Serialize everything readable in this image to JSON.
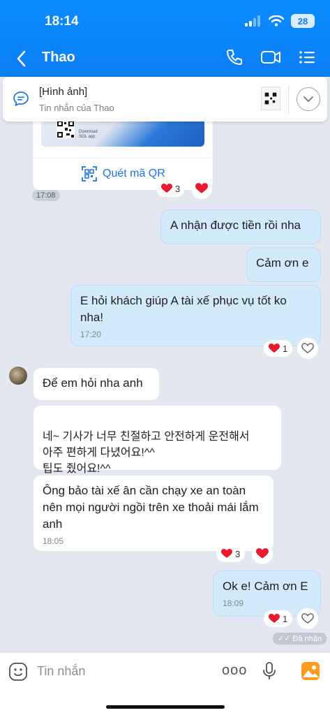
{
  "status": {
    "time": "18:14",
    "battery": "28"
  },
  "header": {
    "title": "Thao"
  },
  "pinned": {
    "title": "[Hình ảnh]",
    "subtitle": "Tin nhắn của Thao"
  },
  "image_card": {
    "download_text": "Download",
    "app_text": "SOL app",
    "qr_link": "Quét mã QR",
    "time": "17:08"
  },
  "reactions_1": {
    "count": "3"
  },
  "messages": [
    {
      "text": "A nhận được tiền rồi nha"
    },
    {
      "text": "Cảm ơn e"
    },
    {
      "text": "E hỏi khách giúp A tài xế phục vụ tốt ko nha!",
      "time": "17:20",
      "react_count": "1"
    },
    {
      "text": "Để em hỏi nha anh"
    },
    {
      "text": "네~ 기사가 너무 친절하고 안전하게 운전해서\n아주 편하게 다녔어요!^^\n팁도 줬어요!^^"
    },
    {
      "text": "Ông bảo tài xế ân cần chạy xe an toàn nên mọi người ngồi trên xe thoải mái lắm anh",
      "time": "18:05",
      "react_count": "3"
    },
    {
      "text": "Ok e! Cảm ơn E",
      "time": "18:09",
      "react_count": "1"
    }
  ],
  "seen_label": "Đã nhận",
  "input": {
    "placeholder": "Tin nhắn",
    "more": "ooo"
  },
  "colors": {
    "header_blue": "#0b7ef5",
    "out_bubble": "#d3eafb",
    "heart": "#e8192c"
  }
}
